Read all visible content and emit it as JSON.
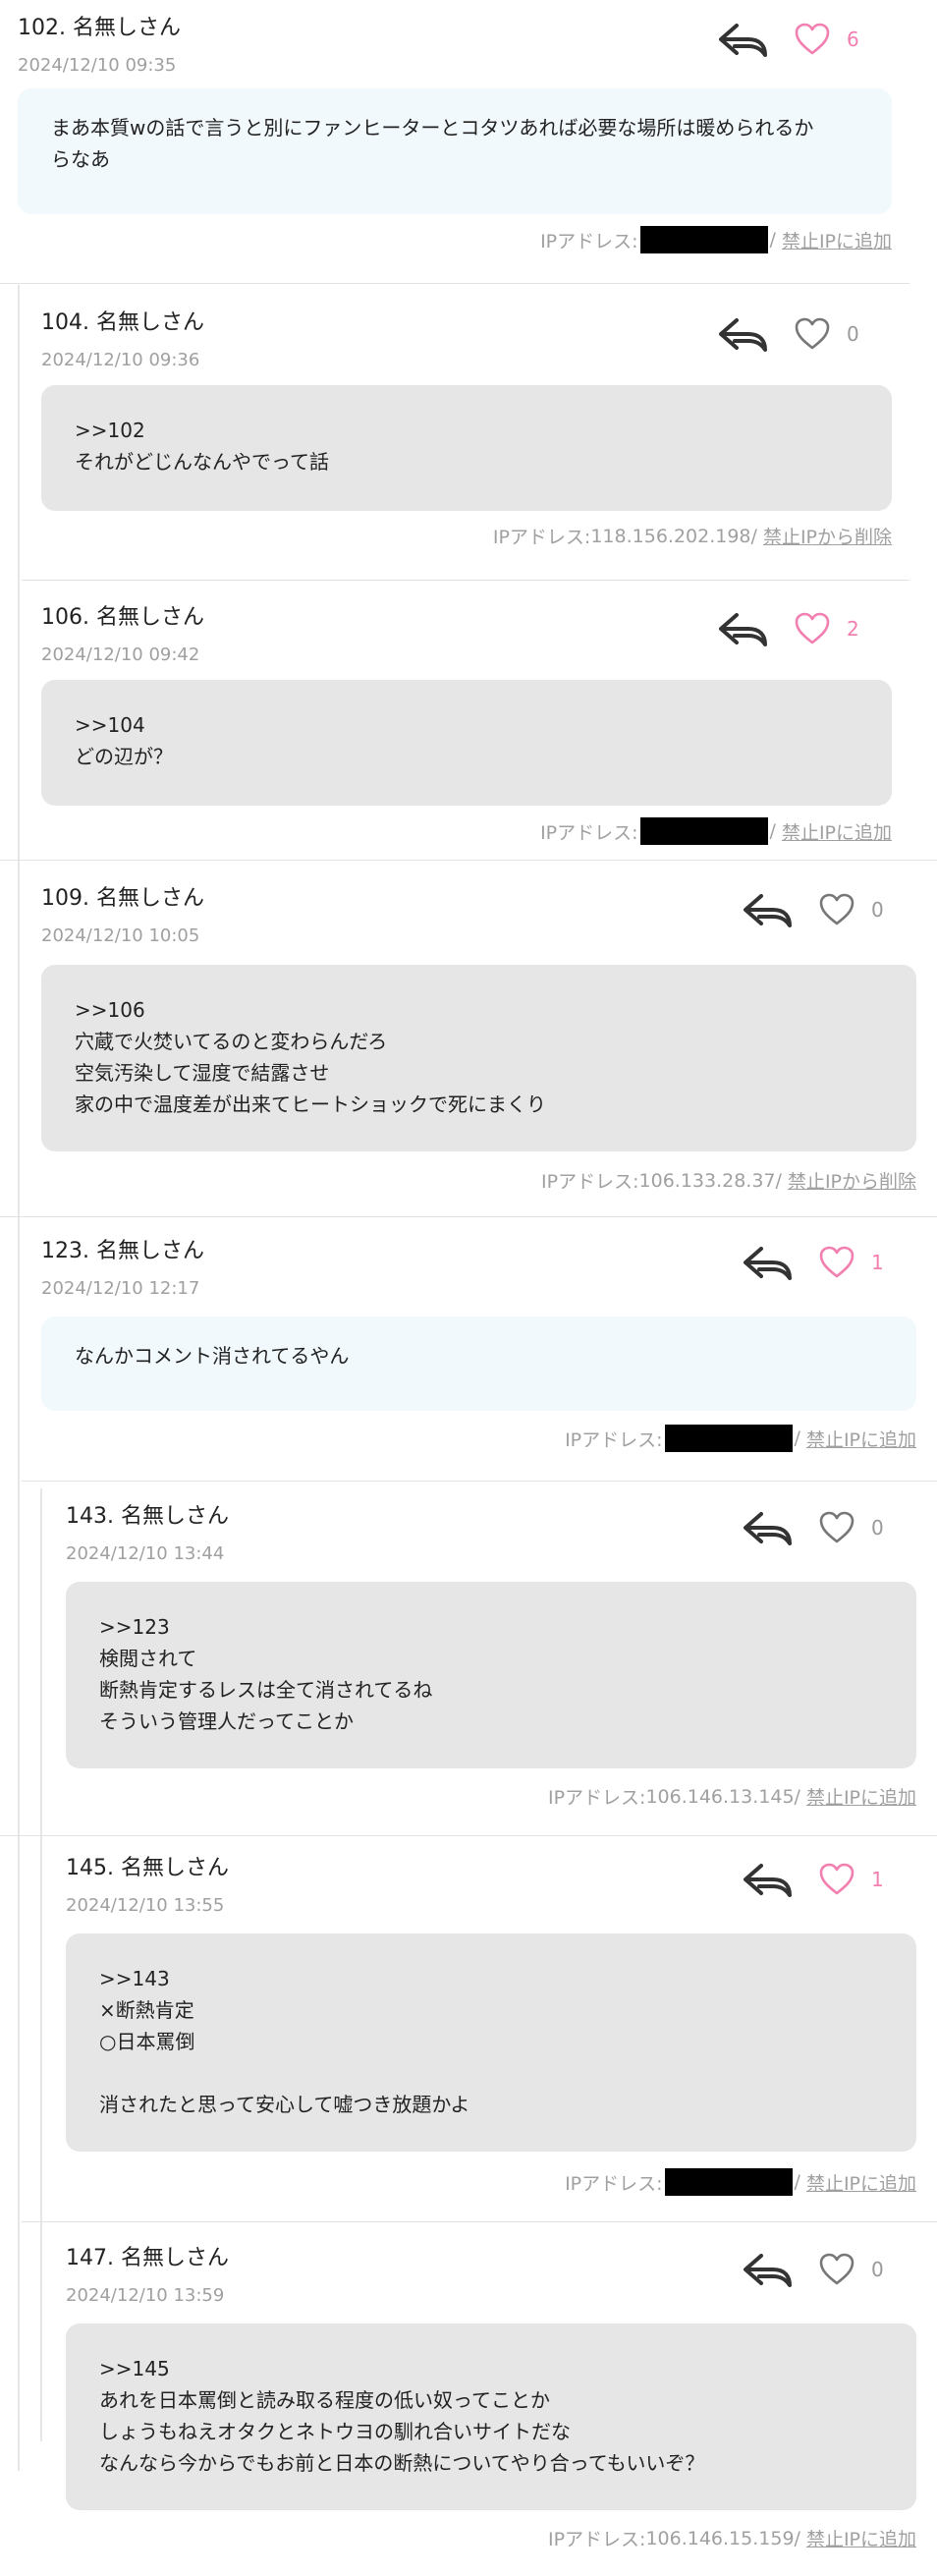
{
  "posts": [
    {
      "num": "102.",
      "name": "名無しさん",
      "date": "2024/12/10 09:35",
      "likes": "6",
      "liked": true,
      "bg": "blue",
      "lines": [
        "まあ本質wの話で言うと別にファンヒーターとコタツあれば必要な場所は暖められるか",
        "らなあ"
      ],
      "ip_label": "IPアドレス:",
      "ip": "",
      "ip_masked": true,
      "sep": "/",
      "action": "禁止IPに追加"
    },
    {
      "num": "104.",
      "name": "名無しさん",
      "date": "2024/12/10 09:36",
      "likes": "0",
      "liked": false,
      "bg": "gray",
      "lines": [
        ">>102",
        "それがどじんなんやでって話"
      ],
      "ip_label": "IPアドレス:",
      "ip": "118.156.202.198",
      "ip_masked": false,
      "sep": " / ",
      "action": "禁止IPから削除"
    },
    {
      "num": "106.",
      "name": "名無しさん",
      "date": "2024/12/10 09:42",
      "likes": "2",
      "liked": true,
      "bg": "gray",
      "lines": [
        ">>104",
        "どの辺が？"
      ],
      "ip_label": "IPアドレス:",
      "ip": "",
      "ip_masked": true,
      "sep": "/",
      "action": "禁止IPに追加"
    },
    {
      "num": "109.",
      "name": "名無しさん",
      "date": "2024/12/10 10:05",
      "likes": "0",
      "liked": false,
      "bg": "gray",
      "lines": [
        ">>106",
        "穴蔵で火焚いてるのと変わらんだろ",
        "空気汚染して湿度で結露させ",
        "家の中で温度差が出来てヒートショックで死にまくり"
      ],
      "ip_label": "IPアドレス:",
      "ip": "106.133.28.37",
      "ip_masked": false,
      "sep": " / ",
      "action": "禁止IPから削除"
    },
    {
      "num": "123.",
      "name": "名無しさん",
      "date": "2024/12/10 12:17",
      "likes": "1",
      "liked": true,
      "bg": "blue",
      "lines": [
        "なんかコメント消されてるやん"
      ],
      "ip_label": "IPアドレス:",
      "ip": "",
      "ip_masked": true,
      "sep": " / ",
      "action": "禁止IPに追加"
    },
    {
      "num": "143.",
      "name": "名無しさん",
      "date": "2024/12/10 13:44",
      "likes": "0",
      "liked": false,
      "bg": "gray",
      "lines": [
        ">>123",
        "検閲されて",
        "断熱肯定するレスは全て消されてるね",
        "そういう管理人だってことか"
      ],
      "ip_label": "IPアドレス:",
      "ip": "106.146.13.145",
      "ip_masked": false,
      "sep": " / ",
      "action": "禁止IPに追加"
    },
    {
      "num": "145.",
      "name": "名無しさん",
      "date": "2024/12/10 13:55",
      "likes": "1",
      "liked": true,
      "bg": "gray",
      "lines": [
        ">>143",
        "×断熱肯定",
        "○日本罵倒",
        "",
        "消されたと思って安心して嘘つき放題かよ"
      ],
      "ip_label": "IPアドレス:",
      "ip": "",
      "ip_masked": true,
      "sep": " / ",
      "action": "禁止IPに追加"
    },
    {
      "num": "147.",
      "name": "名無しさん",
      "date": "2024/12/10 13:59",
      "likes": "0",
      "liked": false,
      "bg": "gray",
      "lines": [
        ">>145",
        "あれを日本罵倒と読み取る程度の低い奴ってことか",
        "しょうもねえオタクとネトウヨの馴れ合いサイトだな",
        "なんなら今からでもお前と日本の断熱についてやり合ってもいいぞ？"
      ],
      "ip_label": "IPアドレス:",
      "ip": "106.146.15.159",
      "ip_masked": false,
      "sep": " / ",
      "action": "禁止IPに追加"
    }
  ],
  "colors": {
    "liked": "#f27fb0",
    "unliked": "#777777",
    "icon": "#333333",
    "gray_box": "#e6e6e6",
    "blue_box": "#f2f9fd"
  }
}
